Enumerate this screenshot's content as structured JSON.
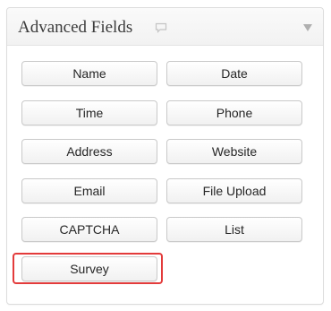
{
  "panel": {
    "title": "Advanced Fields",
    "comment_icon": "speech-bubble-icon",
    "toggle_icon": "triangle-down-icon"
  },
  "buttons": [
    "Name",
    "Date",
    "Time",
    "Phone",
    "Address",
    "Website",
    "Email",
    "File Upload",
    "CAPTCHA",
    "List",
    "Survey"
  ],
  "highlight": {
    "target": "Survey",
    "color": "#e33b3b"
  }
}
